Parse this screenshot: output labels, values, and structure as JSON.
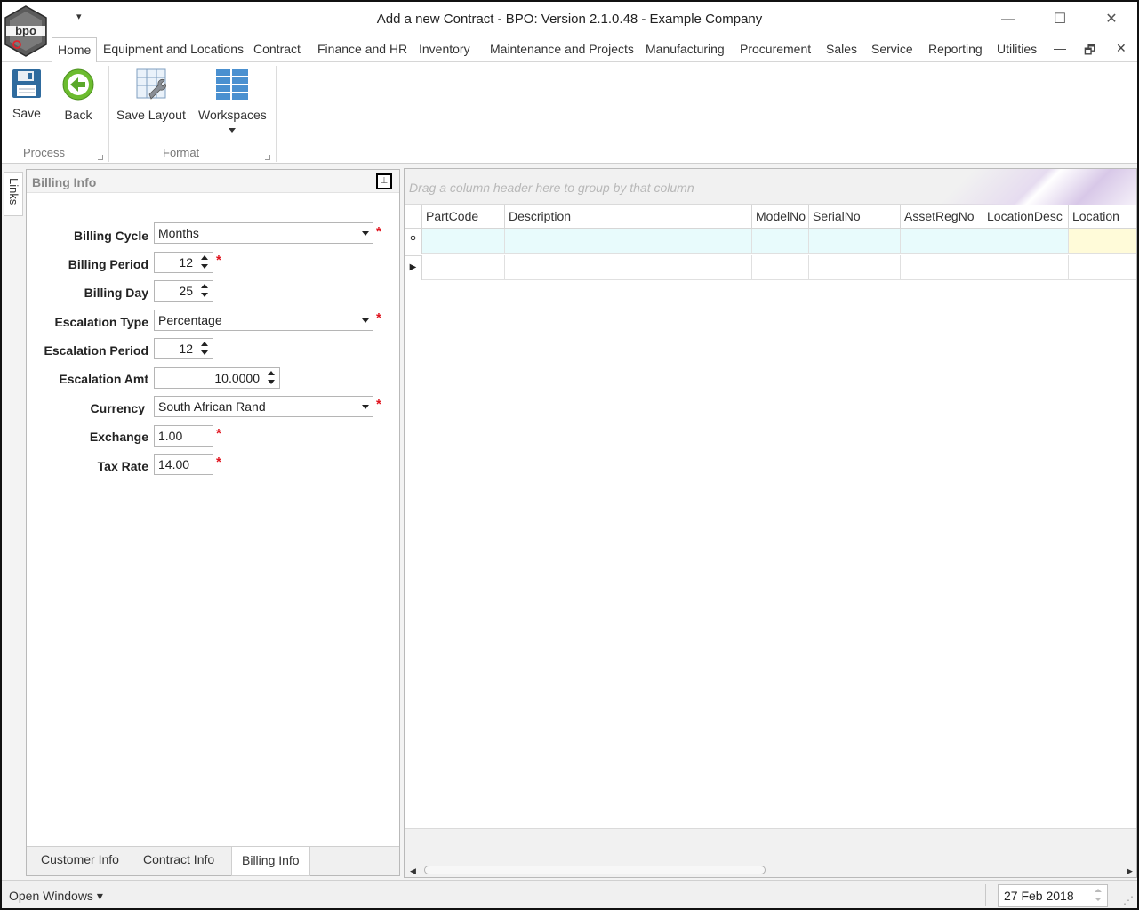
{
  "window": {
    "title": "Add a new Contract - BPO: Version 2.1.0.48 - Example Company",
    "logo_text": "bpo",
    "qat_symbol": "▾",
    "minimize_symbol": "—",
    "maximize_symbol": "☐",
    "close_symbol": "✕"
  },
  "menu": {
    "tabs": [
      "Home",
      "Equipment and Locations",
      "Contract",
      "Finance and HR",
      "Inventory",
      "Maintenance and Projects",
      "Manufacturing",
      "Procurement",
      "Sales",
      "Service",
      "Reporting",
      "Utilities"
    ],
    "active": "Home",
    "mdi_minimize": "—",
    "mdi_restore": "🗗",
    "mdi_close": "✕"
  },
  "ribbon": {
    "save_label": "Save",
    "back_label": "Back",
    "save_layout_label": "Save Layout",
    "workspaces_label": "Workspaces",
    "group_process": "Process",
    "group_format": "Format"
  },
  "links_tab": "Links",
  "billing_panel": {
    "title": "Billing Info",
    "pin_symbol": "⊥",
    "fields": {
      "billing_cycle_label": "Billing Cycle",
      "billing_cycle_value": "Months",
      "billing_period_label": "Billing Period",
      "billing_period_value": "12",
      "billing_day_label": "Billing Day",
      "billing_day_value": "25",
      "escalation_type_label": "Escalation Type",
      "escalation_type_value": "Percentage",
      "escalation_period_label": "Escalation Period",
      "escalation_period_value": "12",
      "escalation_amt_label": "Escalation Amt",
      "escalation_amt_value": "10.0000",
      "currency_label": "Currency",
      "currency_value": "South African Rand",
      "exchange_label": "Exchange",
      "exchange_value": "1.00",
      "tax_rate_label": "Tax Rate",
      "tax_rate_value": "14.00"
    },
    "required_marker": "*",
    "tabs": [
      "Customer Info",
      "Contract Info",
      "Billing Info"
    ],
    "active_tab": "Billing Info"
  },
  "grid": {
    "group_hint": "Drag a column header here to group by that column",
    "columns": [
      "PartCode",
      "Description",
      "ModelNo",
      "SerialNo",
      "AssetRegNo",
      "LocationDesc",
      "Location"
    ],
    "new_row_indicator": "⚲",
    "row_indicator": "▶",
    "scroll_left": "◀",
    "scroll_right": "▶",
    "new_row_color": "#e8fbfc",
    "location_cell_color": "#fffbd9"
  },
  "statusbar": {
    "open_windows": "Open Windows ▾",
    "date": "27 Feb 2018",
    "grip": "⋰"
  }
}
